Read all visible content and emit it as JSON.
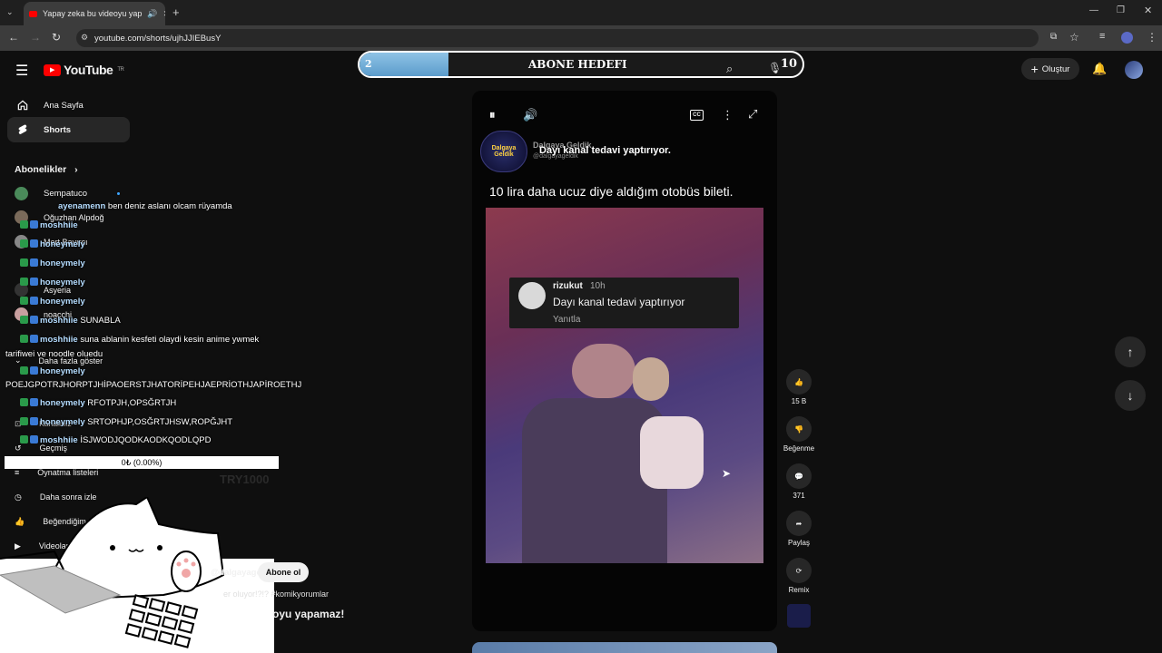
{
  "browser": {
    "tab_title": "Yapay zeka bu videoyu yap",
    "url": "youtube.com/shorts/ujhJJIEBusY"
  },
  "youtube": {
    "logo_text": "YouTube",
    "region": "TR",
    "create_label": "Oluştur"
  },
  "goal_overlay": {
    "left_value": "2",
    "label": "ABONE HEDEFI",
    "right_value": "10",
    "progress_fraction": 0.2
  },
  "sidebar": {
    "home": "Ana Sayfa",
    "shorts": "Shorts",
    "subs_header": "Abonelikler",
    "channels": [
      "Sempatuco",
      "Oğuzhan Alpdoğ",
      "Mert Bayırcı",
      "Asyeria",
      "noacchi"
    ],
    "show_more": "Daha fazla göster",
    "you_section": [
      "Kanalınız",
      "Geçmiş",
      "Oynatma listeleri",
      "Daha sonra izle",
      "Beğendiğim vi",
      "Videolar"
    ]
  },
  "short": {
    "channel_name": "Dalgaya Geldik",
    "channel_handle": "@dalgayageldik",
    "overlay_title": "Dayı kanal tedavi yaptırıyor.",
    "caption": "10 lira daha ucuz diye aldığım otobüs bileti.",
    "comment_user": "rizukut",
    "comment_time": "10h",
    "comment_text": "Dayı kanal tedavi yaptırıyor",
    "comment_reply": "Yanıtla",
    "bottom_channel": "@dalgayageldik",
    "subscribe": "Abone ol",
    "description": "er oluyor!?!? #komikyorumlar",
    "title_fragment": "oyu yapamaz!"
  },
  "actions": {
    "likes": "15 B",
    "dislike": "Beğenme",
    "comments": "371",
    "share": "Paylaş",
    "remix": "Remix"
  },
  "chat": [
    {
      "user": "ayenamenn",
      "msg": "ben deniz aslanı olcam rüyamda"
    },
    {
      "user": "moshhiie",
      "msg": ""
    },
    {
      "user": "honeymely",
      "msg": ""
    },
    {
      "user": "honeymely",
      "msg": ""
    },
    {
      "user": "honeymely",
      "msg": ""
    },
    {
      "user": "honeymely",
      "msg": ""
    },
    {
      "user": "moshhiie",
      "msg": "SUNABLA"
    },
    {
      "user": "moshhiie",
      "msg": "suna ablanin kesfeti olaydi kesin anime ywmek"
    },
    {
      "user": "",
      "msg": "tarifiwei ve noodle oluedu"
    },
    {
      "user": "honeymely",
      "msg": ""
    },
    {
      "user": "",
      "msg": "POEJGPOTRJHORPTJHİPAOERSTJHATORİPEHJAEPRİOTHJAPİROETHJ"
    },
    {
      "user": "honeymely",
      "msg": "RFOTPJH,OPSĞRTJH"
    },
    {
      "user": "honeymely",
      "msg": "SRTOPHJP,OSĞRTJHSW,ROPĞJHT"
    },
    {
      "user": "moshhiie",
      "msg": "İSJWODJQODKAODKQODLQPD"
    }
  ],
  "donation_bar": "0₺ (0.00%)",
  "ghost_amount": "TRY1000",
  "colors": {
    "accent": "#ff0000",
    "goal_fill": "#6ba9d6"
  }
}
